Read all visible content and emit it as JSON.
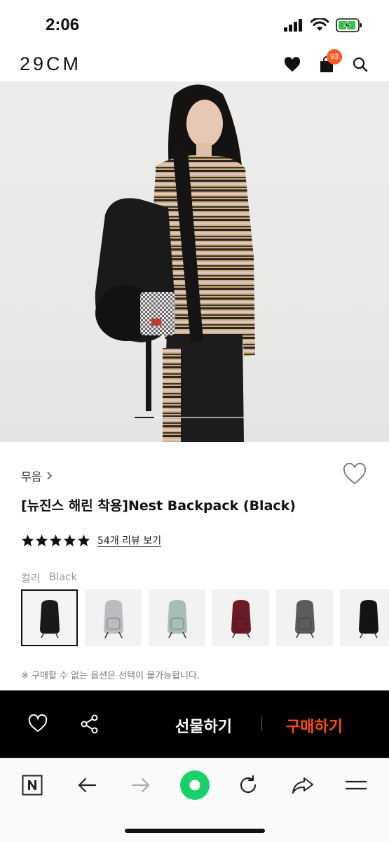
{
  "status": {
    "time": "2:06"
  },
  "header": {
    "logo": "29CM",
    "cart_count": "93"
  },
  "product": {
    "brand": "무음",
    "title": "[뉴진스 해린 착용]Nest Backpack (Black)",
    "rating_stars": 5,
    "review_link": "54개 리뷰 보기",
    "color_label": "컬러",
    "color_selected": "Black",
    "notice": "※ 구매할 수 없는 옵션은 선택이 불가능합니다.",
    "swatch_colors": [
      "#1a1a1a",
      "#b9bcc0",
      "#a9bdb2",
      "#6b1a27",
      "#5e5c5b",
      "#141414"
    ]
  },
  "actions": {
    "gift_label": "선물하기",
    "buy_label": "구매하기"
  },
  "colors": {
    "accent": "#ff4b14",
    "badge": "#ff5a1f"
  }
}
